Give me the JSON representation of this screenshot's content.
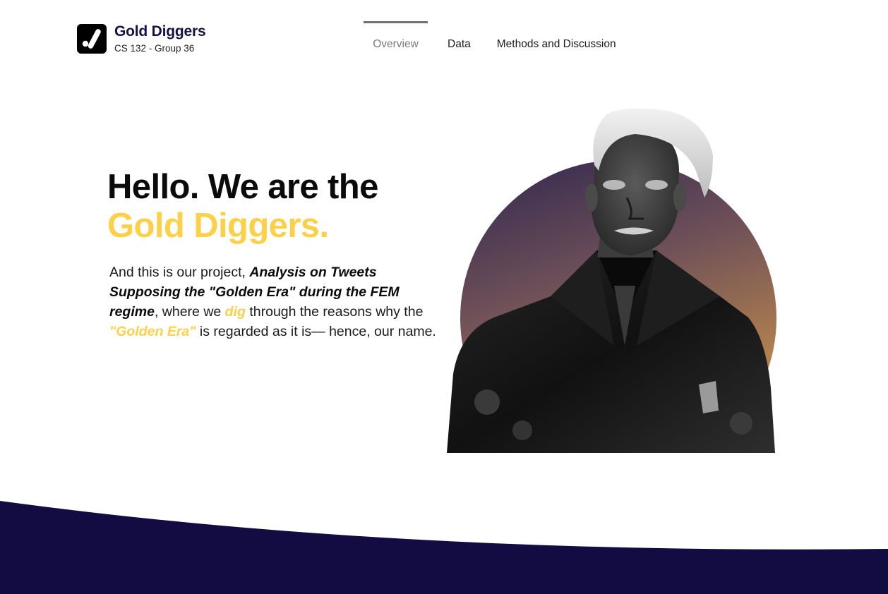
{
  "brand": {
    "logo_icon": "check-mark-icon",
    "name": "Gold Diggers",
    "subtitle": "CS 132 - Group 36"
  },
  "nav": {
    "tabs": [
      {
        "label": "Overview",
        "active": true
      },
      {
        "label": "Data",
        "active": false
      },
      {
        "label": "Methods and Discussion",
        "active": false
      }
    ]
  },
  "hero": {
    "line1": "Hello. We are the",
    "line2": "Gold Diggers.",
    "body": {
      "part1": "And this is our project, ",
      "project_title": "Analysis on Tweets Supposing the \"Golden Era\" during the FEM regime",
      "part2": ", where we ",
      "dig": "dig",
      "part3": " through the reasons why the ",
      "golden_era": "\"Golden Era\"",
      "part4": " is regarded as it is— hence, our name."
    }
  },
  "colors": {
    "brand_navy": "#13104a",
    "gold": "#fcd048",
    "footer_navy": "#120c42",
    "circle_top": "#3d2e57",
    "circle_bottom": "#c08b48"
  }
}
